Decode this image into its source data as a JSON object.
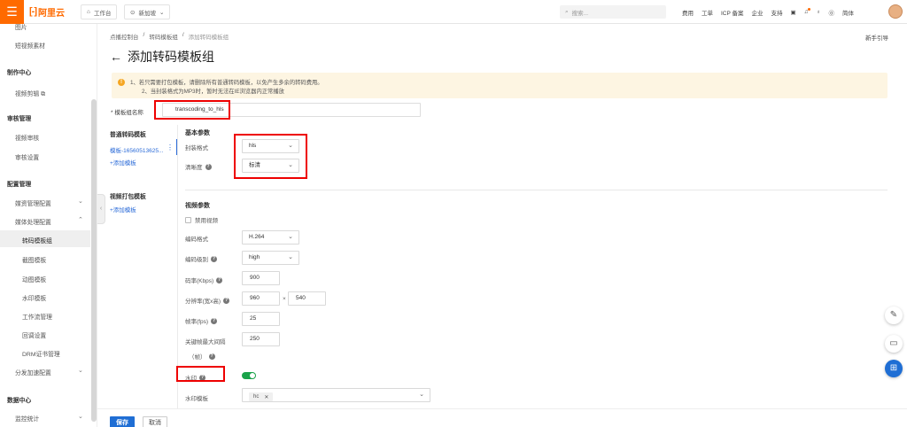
{
  "topbar": {
    "logo_text": "阿里云",
    "workbench": "工作台",
    "region": "新加坡",
    "search_placeholder": "搜索...",
    "links": [
      "费用",
      "工单",
      "ICP 备案",
      "企业",
      "支持"
    ],
    "language": "简体"
  },
  "sidebar": {
    "items": [
      {
        "label": "图片",
        "kind": "item"
      },
      {
        "label": "短视频素材",
        "kind": "item"
      },
      {
        "label": "制作中心",
        "kind": "group"
      },
      {
        "label": "视频剪辑",
        "kind": "item"
      },
      {
        "label": "审核管理",
        "kind": "group"
      },
      {
        "label": "视频审核",
        "kind": "item"
      },
      {
        "label": "审核设置",
        "kind": "item"
      },
      {
        "label": "配置管理",
        "kind": "group"
      },
      {
        "label": "媒资管理配置",
        "kind": "item"
      },
      {
        "label": "媒体处理配置",
        "kind": "item"
      },
      {
        "label": "转码模板组",
        "kind": "sub"
      },
      {
        "label": "截图模板",
        "kind": "sub"
      },
      {
        "label": "动图模板",
        "kind": "sub"
      },
      {
        "label": "水印模板",
        "kind": "sub"
      },
      {
        "label": "工作流管理",
        "kind": "sub"
      },
      {
        "label": "回调设置",
        "kind": "sub"
      },
      {
        "label": "DRM证书管理",
        "kind": "sub"
      },
      {
        "label": "分发加速配置",
        "kind": "item"
      },
      {
        "label": "数据中心",
        "kind": "group"
      },
      {
        "label": "监控统计",
        "kind": "item"
      }
    ]
  },
  "breadcrumb": [
    "点播控制台",
    "转码模板组",
    "添加转码模板组"
  ],
  "guide": "新手引导",
  "page_title": "添加转码模板组",
  "notice": {
    "line1": "1、若只需要打包模板，请删除所有普通转码模板，以免产生多余的转码费用。",
    "line2": "2、当封装格式为MP3时，暂时无法在IE浏览器内正常播放"
  },
  "form": {
    "name_label": "* 模板组名称",
    "name_value": "transcoding_to_hls"
  },
  "left_col": {
    "normal_title": "普通转码模板",
    "template_item": "模板-16560513625...",
    "add_template": "+添加模板",
    "package_title": "视频打包模板",
    "add_template2": "+添加模板"
  },
  "basic": {
    "title": "基本参数",
    "format_label": "封装格式",
    "format_value": "hls",
    "definition_label": "清晰度",
    "definition_value": "标清"
  },
  "video": {
    "title": "视频参数",
    "disable_video": "禁用视频",
    "codec_label": "编码格式",
    "codec_value": "H.264",
    "profile_label": "编码级别",
    "profile_value": "high",
    "bitrate_label": "码率(Kbps)",
    "bitrate_value": "900",
    "resolution_label": "分辨率(宽x高)",
    "width_value": "960",
    "times": "×",
    "height_value": "540",
    "fps_label": "帧率(fps)",
    "fps_value": "25",
    "gop_label": "关键帧最大间隔",
    "gop_label2": "（帧）",
    "gop_value": "250",
    "watermark_label": "水印",
    "watermark_enabled": true,
    "watermark_template_label": "水印模板",
    "watermark_tag": "hc"
  },
  "footer": {
    "save": "保存",
    "cancel": "取消"
  }
}
